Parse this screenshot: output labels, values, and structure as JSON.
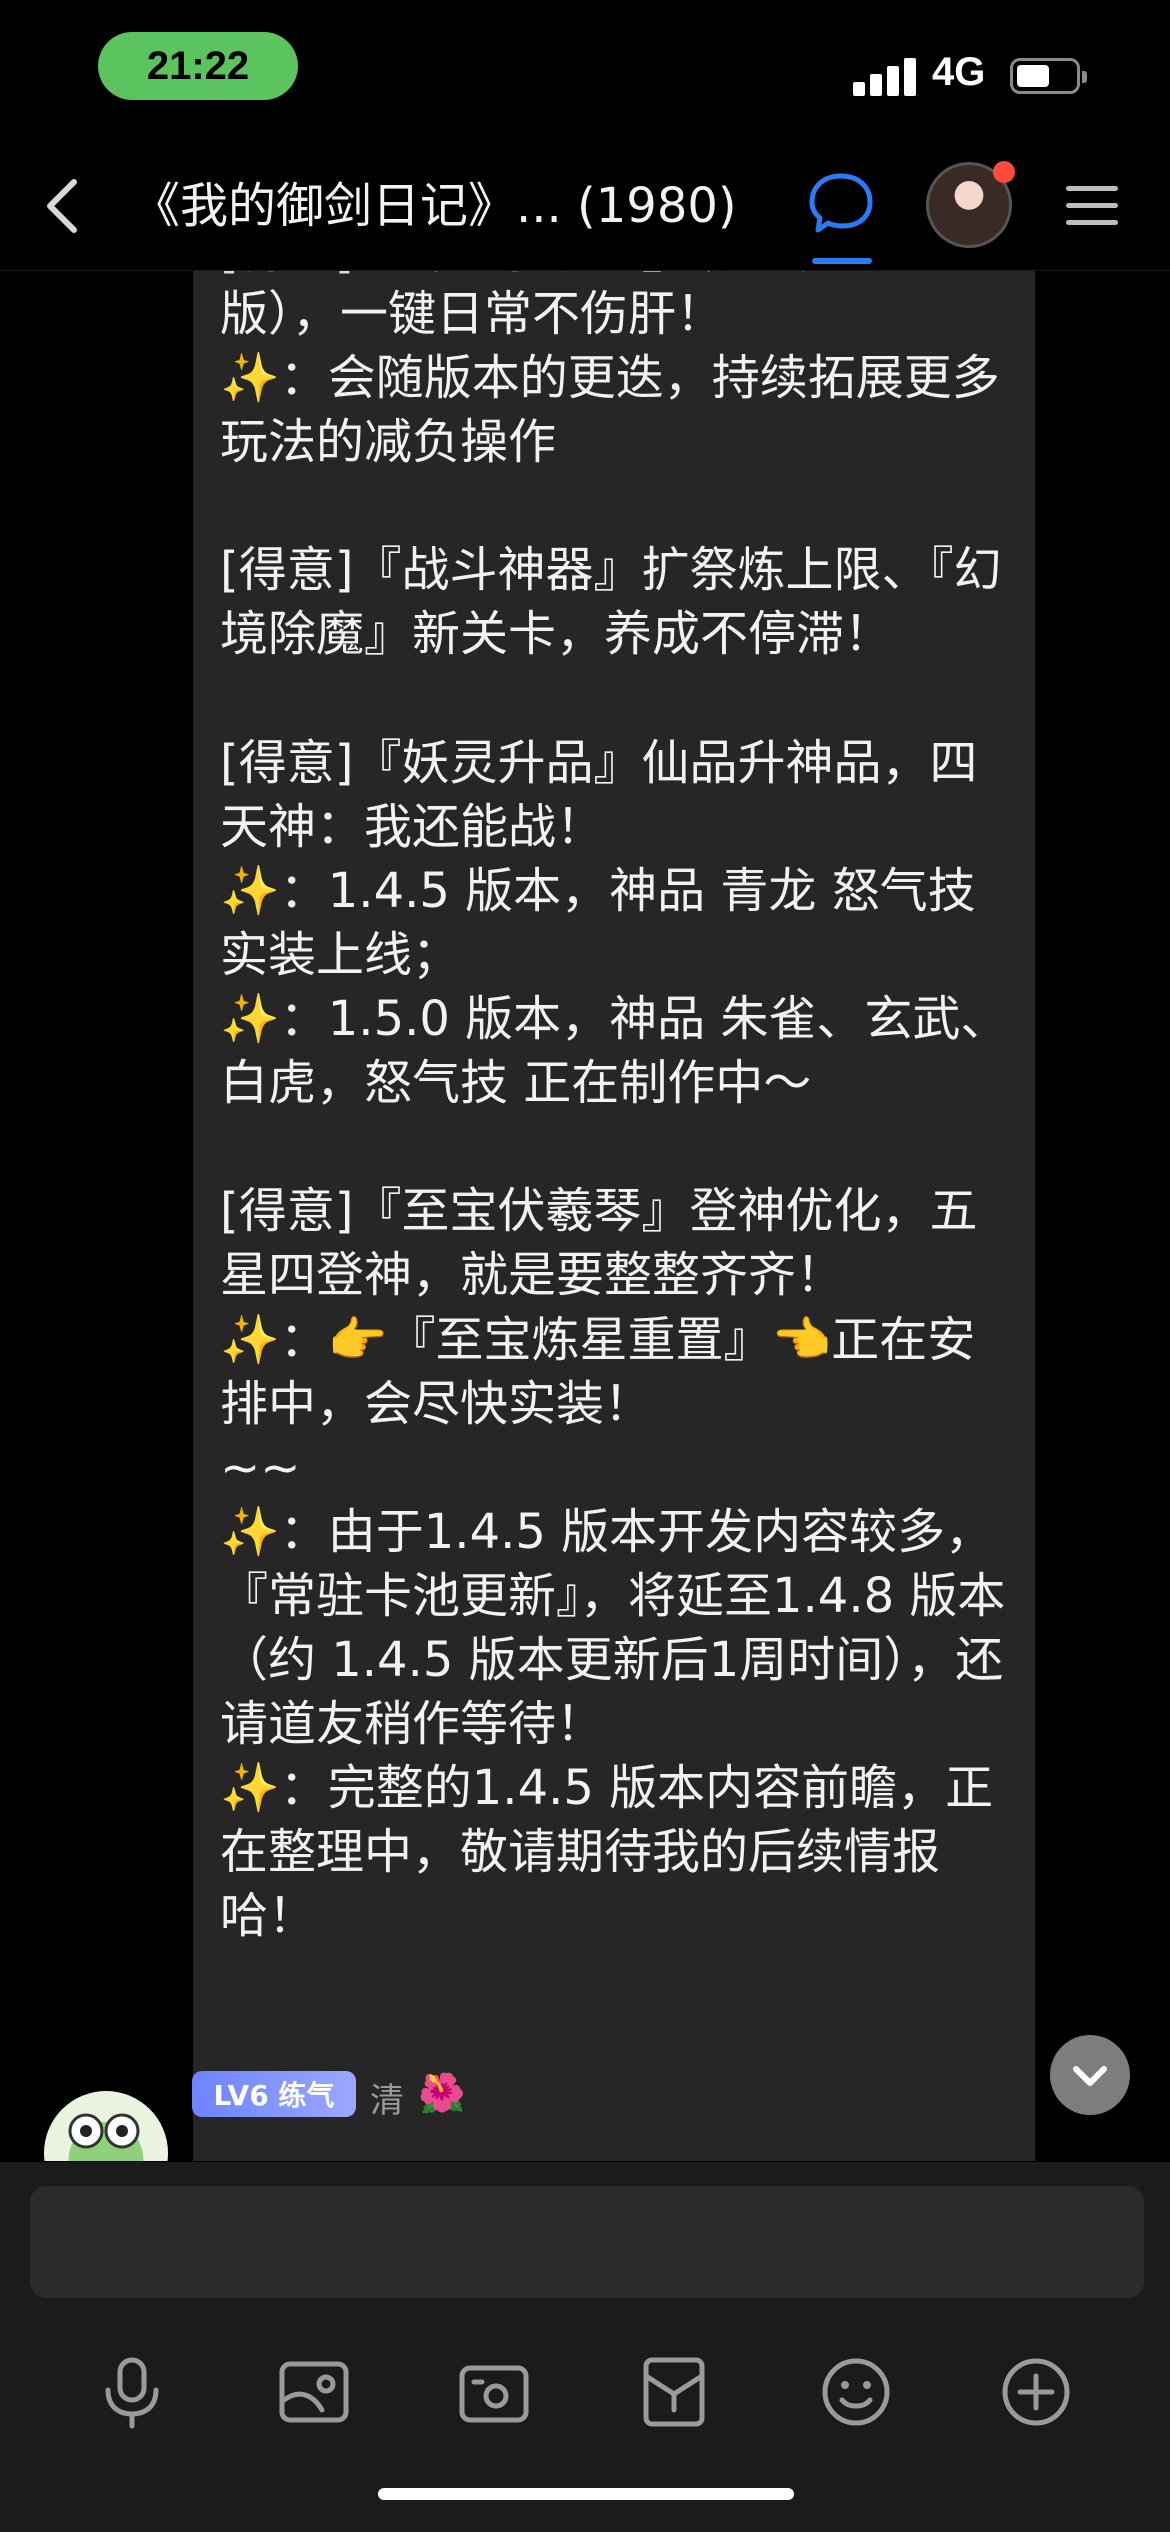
{
  "status_bar": {
    "time": "21:22",
    "network": "4G",
    "battery_level": 0.5
  },
  "nav": {
    "title": "《我的御剑日记》... (1980)",
    "accent_color": "#2a7cf6",
    "icons": [
      "chevron-left-icon",
      "chat-bubble-icon",
      "avatar",
      "menu-icon"
    ]
  },
  "message": {
    "top_partial": "[得意]『御剑小助手』（测试",
    "text": "版），一键日常不伤肝！\n✨：会随版本的更迭，持续拓展更多玩法的减负操作\n\n[得意]『战斗神器』扩祭炼上限、『幻境除魔』新关卡，养成不停滞！\n\n[得意]『妖灵升品』仙品升神品，四天神：我还能战！\n✨：1.4.5 版本，神品 青龙 怒气技实装上线；\n✨：1.5.0 版本，神品 朱雀、玄武、白虎，怒气技 正在制作中～\n\n[得意]『至宝伏羲琴』登神优化，五星四登神，就是要整整齐齐！\n✨：👉『至宝炼星重置』👈正在安排中，会尽快实装！\n~~\n✨：由于1.4.5 版本开发内容较多，『常驻卡池更新』，将延至1.4.8 版本（约 1.4.5 版本更新后1周时间），还请道友稍作等待！\n✨：完整的1.4.5 版本内容前瞻，正在整理中，敬请期待我的后续情报哈！"
  },
  "next_message": {
    "level_badge": "LV6 练气",
    "sender_name": "清",
    "sender_emoji": "🌺"
  },
  "input": {
    "placeholder": "",
    "tools": [
      "microphone-icon",
      "image-icon",
      "camera-icon",
      "red-packet-icon",
      "emoji-icon",
      "plus-icon"
    ]
  }
}
